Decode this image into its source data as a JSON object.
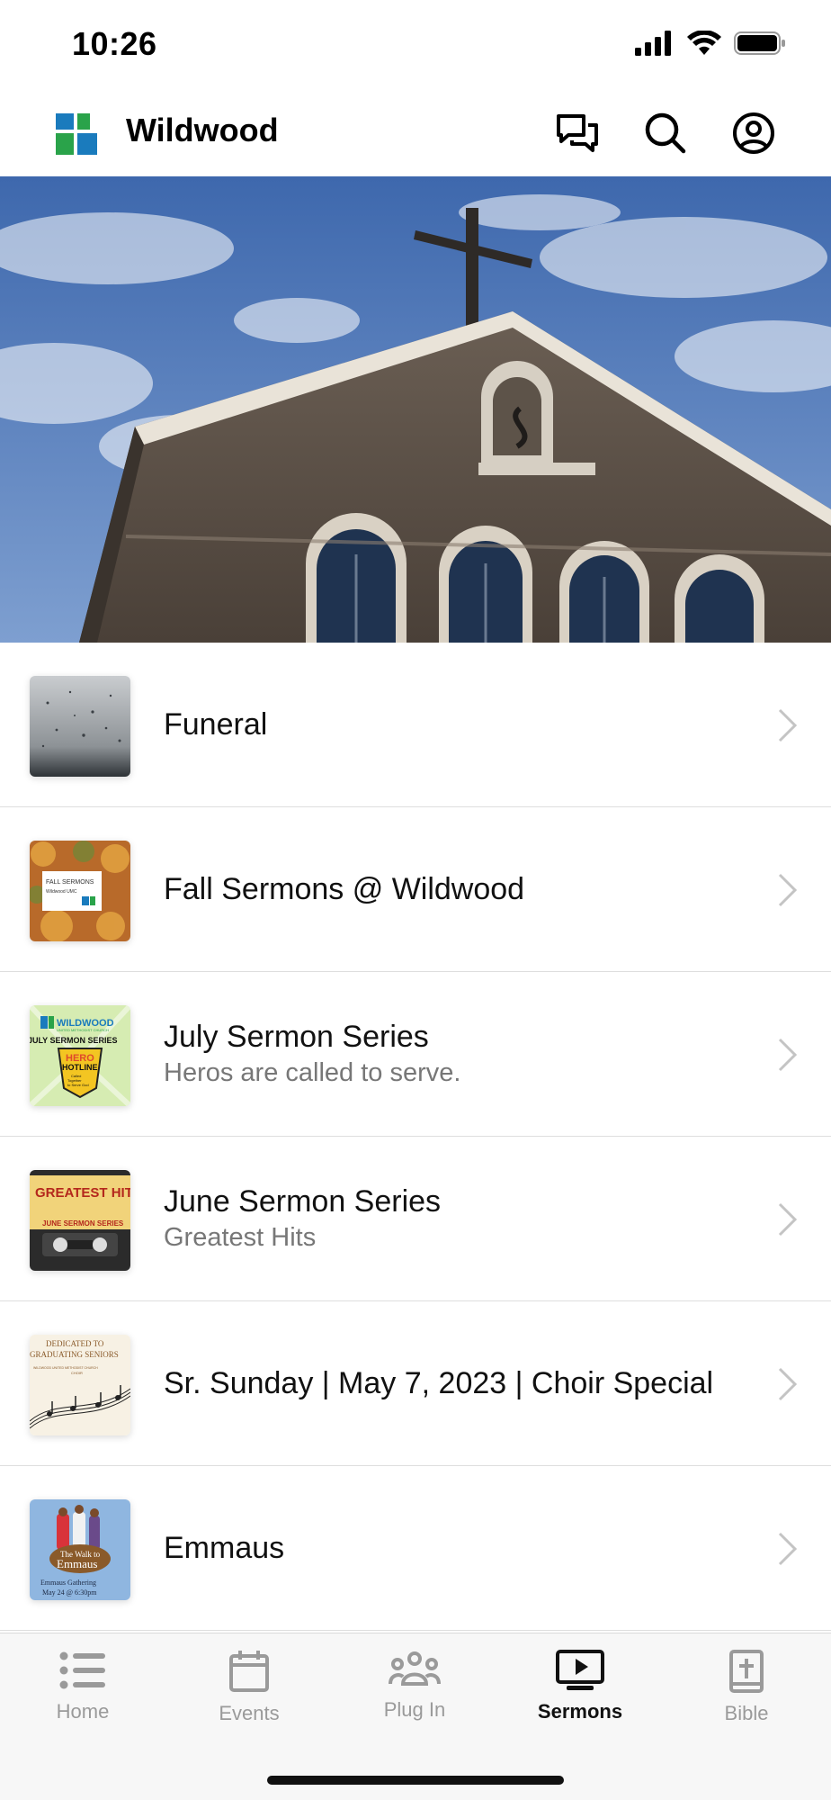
{
  "status_bar": {
    "time": "10:26"
  },
  "header": {
    "title": "Wildwood",
    "logo_colors": [
      "#1a7bbd",
      "#2aa34a"
    ]
  },
  "hero": {
    "alt": ""
  },
  "sermons": [
    {
      "title": "Funeral",
      "subtitle": "",
      "thumb": "rain-window"
    },
    {
      "title": "Fall Sermons @ Wildwood",
      "subtitle": "",
      "thumb": "autumn-leaves"
    },
    {
      "title": "July Sermon Series",
      "subtitle": "Heros are called to serve.",
      "thumb": "hero-hotline"
    },
    {
      "title": "June Sermon Series",
      "subtitle": "Greatest Hits",
      "thumb": "cassette"
    },
    {
      "title": "Sr. Sunday | May 7, 2023 | Choir Special",
      "subtitle": "",
      "thumb": "music-notes"
    },
    {
      "title": "Emmaus",
      "subtitle": "",
      "thumb": "walk-to-emmaus"
    }
  ],
  "thumb_text": {
    "fall": [
      "FALL SERMONS",
      "Wildwood UMC"
    ],
    "july": [
      "WILDWOOD",
      "UNITED METHODIST CHURCH",
      "JULY SERMON SERIES",
      "HERO",
      "HOTLINE",
      "Called Together to Serve God"
    ],
    "june": [
      "GREATEST HITS",
      "JUNE SERMON SERIES"
    ],
    "senior": [
      "DEDICATED TO",
      "GRADUATING SENIORS",
      "WILDWOOD UNITED METHODIST CHURCH",
      "CHOIR"
    ],
    "emmaus": [
      "The Walk to",
      "Emmaus",
      "Emmaus Gathering",
      "May 24 @ 6:30pm"
    ]
  },
  "tabs": [
    {
      "label": "Home",
      "icon": "list-icon",
      "active": false
    },
    {
      "label": "Events",
      "icon": "calendar-icon",
      "active": false
    },
    {
      "label": "Plug In",
      "icon": "group-icon",
      "active": false
    },
    {
      "label": "Sermons",
      "icon": "play-screen-icon",
      "active": true
    },
    {
      "label": "Bible",
      "icon": "bible-icon",
      "active": false
    }
  ],
  "colors": {
    "active_tab": "#111111",
    "inactive_tab": "#9a9a9a",
    "sky": "#5f86c4"
  }
}
